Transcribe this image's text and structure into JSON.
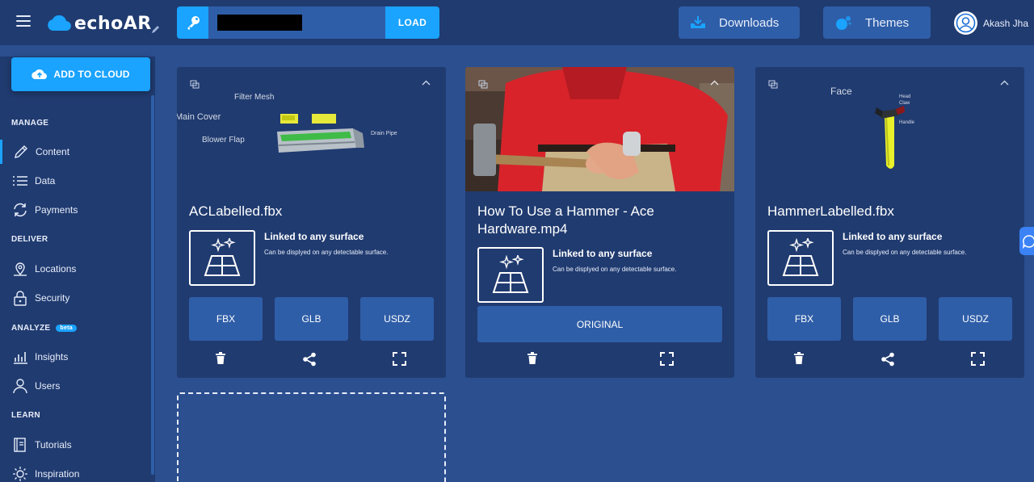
{
  "header": {
    "brand": "echoAR",
    "load_label": "LOAD",
    "downloads_label": "Downloads",
    "themes_label": "Themes",
    "user_name": "Akash Jha"
  },
  "sidebar": {
    "add_cloud_label": "ADD TO CLOUD",
    "sections": {
      "manage": "MANAGE",
      "deliver": "DELIVER",
      "analyze": "ANALYZE",
      "analyze_badge": "beta",
      "learn": "LEARN"
    },
    "items": {
      "content": "Content",
      "data": "Data",
      "payments": "Payments",
      "locations": "Locations",
      "security": "Security",
      "insights": "Insights",
      "users": "Users",
      "tutorials": "Tutorials",
      "inspiration": "Inspiration"
    }
  },
  "cards": [
    {
      "title": "ACLabelled.fbx",
      "thumb_labels": [
        "Filter Mesh",
        "Main Cover",
        "Blower Flap",
        "Drain Pipe"
      ],
      "surface_title": "Linked to any surface",
      "surface_desc": "Can be displyed on any detectable surface.",
      "buttons": [
        "FBX",
        "GLB",
        "USDZ"
      ]
    },
    {
      "title": "How To Use a Hammer - Ace Hardware.mp4",
      "surface_title": "Linked to any surface",
      "surface_desc": "Can be displyed on any detectable surface.",
      "buttons": [
        "ORIGINAL"
      ]
    },
    {
      "title": "HammerLabelled.fbx",
      "thumb_labels": [
        "Face",
        "Head",
        "Claw",
        "Handle"
      ],
      "surface_title": "Linked to any surface",
      "surface_desc": "Can be displyed on any detectable surface.",
      "buttons": [
        "FBX",
        "GLB",
        "USDZ"
      ]
    }
  ],
  "colors": {
    "background": "#2b4f8f",
    "panel": "#203b70",
    "button": "#2f5ea8",
    "accent": "#1aa3ff"
  }
}
